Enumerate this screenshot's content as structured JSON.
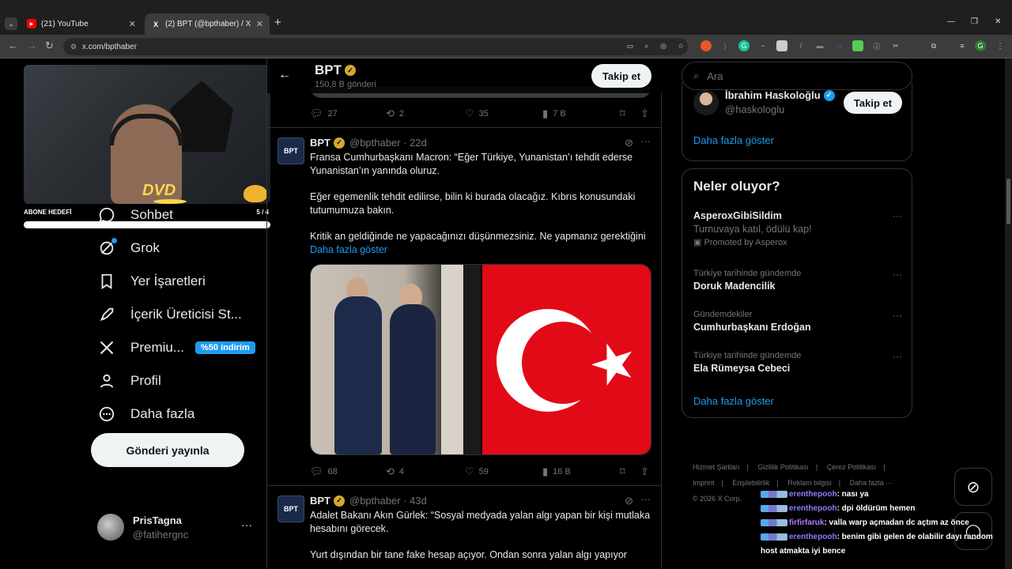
{
  "browser": {
    "tabs": [
      {
        "title": "(21) YouTube",
        "favicon": "youtube-icon"
      },
      {
        "title": "(2) BPT (@bpthaber) / X",
        "favicon": "x-icon"
      }
    ],
    "new_tab": "+",
    "url": "x.com/bpthaber",
    "window_controls": [
      "—",
      "❐",
      "✕"
    ]
  },
  "overlay": {
    "sub_goal_label": "ABONE HEDEFİ",
    "sub_goal_count": "5 / 4",
    "sub_goal_progress": 1.0,
    "dvd_text": "DVD"
  },
  "nav": {
    "items": [
      {
        "label": "Sohbet",
        "icon": "chat-icon"
      },
      {
        "label": "Grok",
        "icon": "grok-icon"
      },
      {
        "label": "Yer İşaretleri",
        "icon": "bookmark-icon"
      },
      {
        "label": "İçerik Üreticisi St...",
        "icon": "rocket-icon"
      },
      {
        "label": "Premiu...",
        "icon": "x-logo-icon",
        "badge": "%50 indirim"
      },
      {
        "label": "Profil",
        "icon": "person-icon"
      },
      {
        "label": "Daha fazla",
        "icon": "more-circle-icon"
      }
    ],
    "post_button": "Gönderi yayınla"
  },
  "account": {
    "name": "PrisTagna",
    "handle": "@fatihergnc",
    "more": "···"
  },
  "header": {
    "title": "BPT",
    "subtitle": "150,8 B gönderi",
    "follow": "Takip et"
  },
  "tweet0_actions": {
    "replies": "27",
    "reposts": "2",
    "likes": "35",
    "views": "7 B"
  },
  "tweets": [
    {
      "avatar": "BPT",
      "name": "BPT",
      "handle": "@bpthaber · 22d",
      "paragraphs": [
        "Fransa Cumhurbaşkanı Macron: “Eğer Türkiye, Yunanistan’ı tehdit ederse Yunanistan’ın yanında oluruz.",
        "Eğer egemenlik tehdit edilirse, bilin ki burada olacağız. Kıbrıs konusundaki tutumumuza bakın.",
        "Kritik an geldiğinde ne yapacağınızı düşünmezsiniz. Ne yapmanız gerektiğini"
      ],
      "show_more": "Daha fazla göster",
      "replies": "68",
      "reposts": "4",
      "likes": "59",
      "views": "16 B"
    },
    {
      "avatar": "BPT",
      "name": "BPT",
      "handle": "@bpthaber · 43d",
      "paragraphs": [
        "Adalet Bakanı Akın Gürlek: “Sosyal medyada yalan algı yapan bir kişi mutlaka hesabını görecek.",
        "Yurt dışından bir tane fake hesap açıyor. Ondan sonra yalan algı yapıyor"
      ]
    }
  ],
  "right": {
    "search_placeholder": "Ara",
    "who_to_follow": {
      "name": "İbrahim Haskoloğlu",
      "handle": "@haskologlu",
      "follow": "Takip et",
      "show_more": "Daha fazla göster"
    },
    "trends_title": "Neler oluyor?",
    "trends": [
      {
        "context": "",
        "title": "AsperoxGibiSildim",
        "desc": "Turnuvaya katıl, ödülü kap!",
        "promo": "Promoted by Asperox"
      },
      {
        "context": "Türkiye tarihinde gündemde",
        "title": "Doruk Madencilik"
      },
      {
        "context": "Gündemdekiler",
        "title": "Cumhurbaşkanı Erdoğan"
      },
      {
        "context": "Türkiye tarihinde gündemde",
        "title": "Ela Rümeysa Cebeci"
      }
    ],
    "trends_more": "Daha fazla göster",
    "footer": [
      "Hizmet Şartları",
      "Gizlilik Politikası",
      "Çerez Politikası",
      "Imprint",
      "Erişilebilirlik",
      "Reklam bilgisi",
      "Daha fazla ···",
      "© 2026 X Corp."
    ]
  },
  "chat": [
    {
      "user": "erenthepooh",
      "text": ": nası ya"
    },
    {
      "user": "erenthepooh",
      "text": ": dpi öldürüm hemen"
    },
    {
      "user": "firfirfaruk",
      "text": ": valla warp açmadan dc açtım az önce"
    },
    {
      "user": "erenthepooh",
      "text": ": benim gibi gelen de olabilir dayı random host atmakta iyi bence"
    }
  ]
}
